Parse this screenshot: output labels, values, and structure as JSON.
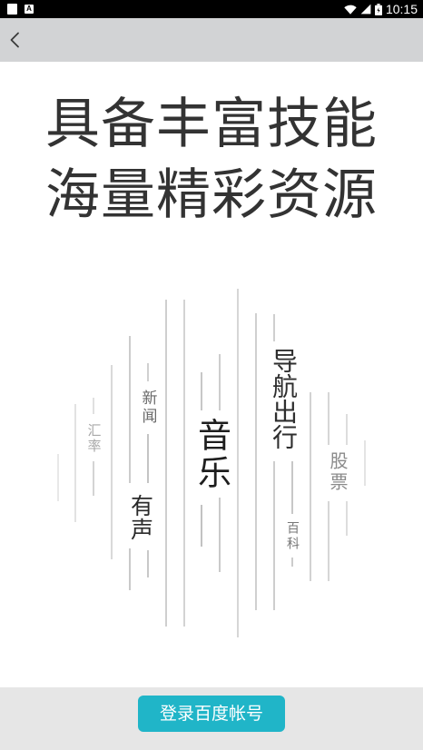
{
  "status_bar": {
    "time": "10:15",
    "notification_glyph": "A",
    "icons": {
      "left": [
        "notification-square-icon",
        "a-notification-icon"
      ],
      "right": [
        "wifi-icon",
        "cell-signal-icon",
        "battery-icon"
      ]
    }
  },
  "app_bar": {
    "back_icon": "chevron-left-icon"
  },
  "headline": {
    "line1": "具备丰富技能",
    "line2": "海量精彩资源"
  },
  "skills": {
    "exchange_rate": "汇率",
    "news": "新闻",
    "audio": "有声",
    "music": "音乐",
    "navigation": "导航出行",
    "encyclopedia": "百科",
    "stocks": "股票"
  },
  "footer": {
    "login_button_label": "登录百度帐号"
  },
  "colors": {
    "status_bar_bg": "#000000",
    "app_bar_bg": "#d2d3d5",
    "content_bg": "#ffffff",
    "footer_bg": "#e6e6e6",
    "accent": "#20b5c8",
    "headline_text": "#333333"
  }
}
